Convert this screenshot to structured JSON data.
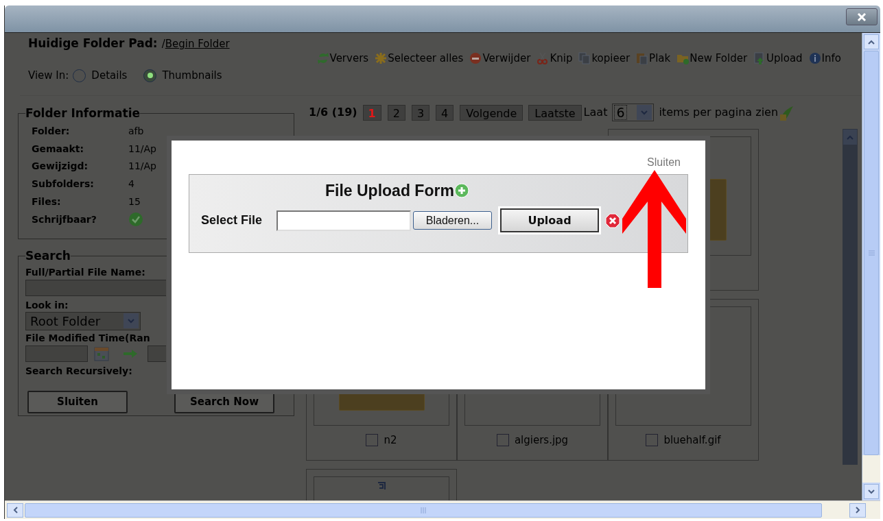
{
  "header": {
    "label": "Huidige Folder Pad:",
    "root": "/",
    "link": "Begin Folder"
  },
  "toolbar": [
    {
      "kind": "refresh",
      "label": "Ververs"
    },
    {
      "kind": "select",
      "label": "Selecteer alles"
    },
    {
      "kind": "delete",
      "label": "Verwijder"
    },
    {
      "kind": "cut",
      "label": "Knip"
    },
    {
      "kind": "copy",
      "label": "kopieer"
    },
    {
      "kind": "paste",
      "label": "Plak"
    },
    {
      "kind": "folder",
      "label": "New Folder"
    },
    {
      "kind": "upload",
      "label": "Upload"
    },
    {
      "kind": "info",
      "label": "Info"
    }
  ],
  "view_in": {
    "label": "View In:",
    "options": [
      {
        "label": "Details",
        "selected": false
      },
      {
        "label": "Thumbnails",
        "selected": true
      }
    ]
  },
  "folder_info": {
    "title": "Folder Informatie",
    "rows": [
      {
        "label": "Folder:",
        "value": "afb"
      },
      {
        "label": "Gemaakt:",
        "value": "11/Ap"
      },
      {
        "label": "Gewijzigd:",
        "value": "11/Ap"
      },
      {
        "label": "Subfolders:",
        "value": "4"
      },
      {
        "label": "Files:",
        "value": "15"
      },
      {
        "label": "Schrijfbaar?",
        "writable": true
      }
    ]
  },
  "search": {
    "title": "Search",
    "name_label": "Full/Partial File Name:",
    "look_in_label": "Look in:",
    "look_in_value": "Root Folder",
    "time_label": "File Modified Time(Ran",
    "recursive_label": "Search Recursively:",
    "buttons": [
      "Sluiten",
      "Search Now"
    ]
  },
  "pagination": {
    "summary": "1/6 (19)",
    "pages": [
      {
        "label": "1",
        "selected": true
      },
      {
        "label": "2",
        "selected": false
      },
      {
        "label": "3",
        "selected": false
      },
      {
        "label": "4",
        "selected": false
      }
    ],
    "next": "Volgende",
    "last": "Laatste",
    "prefix": "Laat",
    "per_page": "6",
    "suffix": "items per pagina zien"
  },
  "thumbnails": [
    {
      "kind": "folder"
    },
    {
      "kind": "folder",
      "name": "n2",
      "checked": false
    },
    {
      "kind": "file",
      "name": "algiers.jpg",
      "checked": false
    },
    {
      "kind": "file",
      "name": "bluehalf.gif",
      "checked": false
    },
    {
      "kind": "link"
    }
  ],
  "dialog": {
    "close_link": "Sluiten",
    "title": "File Upload Form",
    "field_label": "Select File",
    "browse_button": "Bladeren...",
    "upload_button": "Upload"
  }
}
